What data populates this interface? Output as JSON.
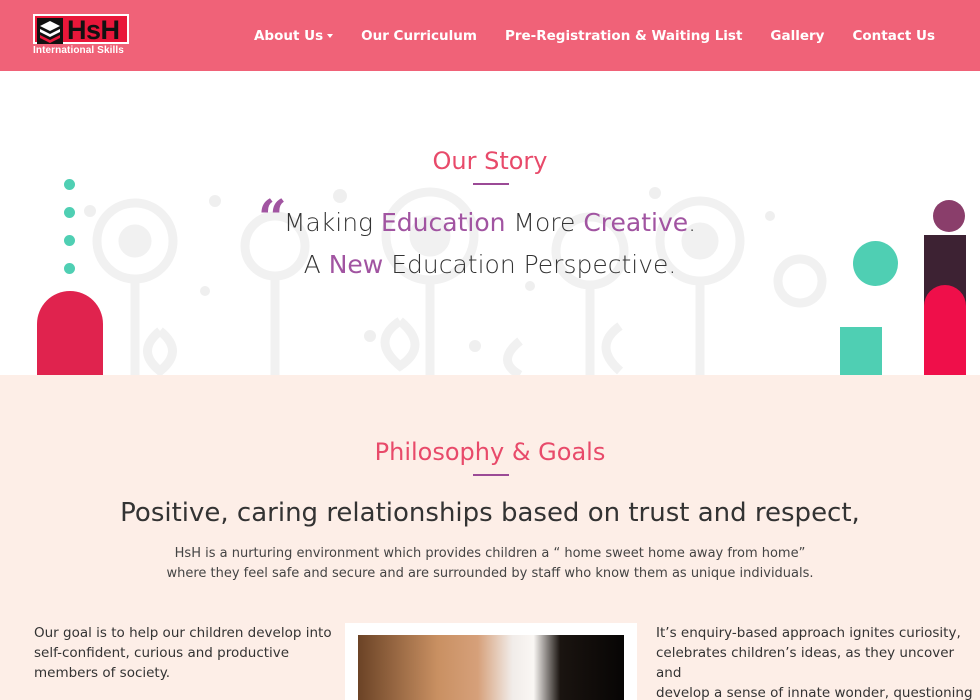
{
  "brand": {
    "logo_text": "HsH",
    "logo_subtitle": "International Skills"
  },
  "nav": {
    "items": [
      {
        "label": "About Us",
        "dropdown": true
      },
      {
        "label": "Our Curriculum",
        "dropdown": false
      },
      {
        "label": "Pre-Registration & Waiting List",
        "dropdown": false
      },
      {
        "label": "Gallery",
        "dropdown": false
      },
      {
        "label": "Contact Us",
        "dropdown": false
      }
    ]
  },
  "story": {
    "title": "Our Story",
    "quote_line1": {
      "pre": "Making ",
      "hl1": "Education",
      "mid": " More ",
      "hl2": "Creative",
      "post": "."
    },
    "quote_line2": {
      "pre": "A ",
      "hl1": "New",
      "post": " Education Perspective."
    }
  },
  "philosophy": {
    "title": "Philosophy & Goals",
    "heading": "Positive, caring relationships based on trust and respect,",
    "paragraph_line1": "HsH is a nurturing environment which provides children a “ home sweet home away from home”",
    "paragraph_line2": "where they feel safe and secure and are surrounded by staff who know them as unique individuals.",
    "left_column": [
      "Our goal is to help our children develop into",
      "self-confident, curious and productive",
      "members of society."
    ],
    "right_column": [
      "It’s enquiry-based approach ignites curiosity,",
      "celebrates children’s ideas, as they uncover and",
      "develop a sense of innate wonder, questioning"
    ]
  },
  "colors": {
    "header": "#f06278",
    "accent_pink": "#e84a6a",
    "accent_purple": "#a154a1",
    "section_bg": "#fdeee7",
    "teal": "#4fcfb3",
    "crimson": "#e0234e"
  }
}
